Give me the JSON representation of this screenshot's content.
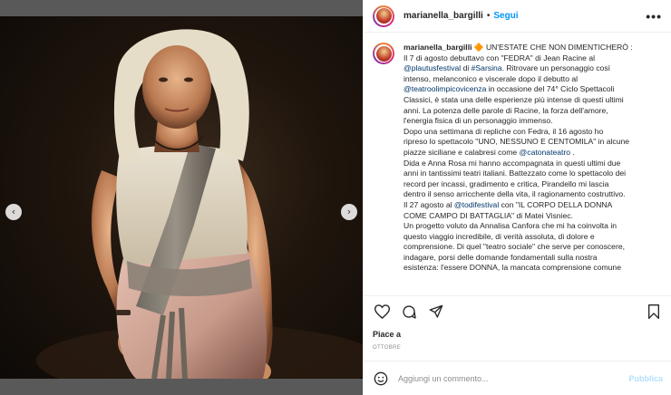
{
  "photo": {
    "prev_glyph": "‹",
    "next_glyph": "›",
    "carousel_dots": 6,
    "active_dot": 0
  },
  "header": {
    "username": "marianella_bargilli",
    "separator": "•",
    "follow_label": "Segui",
    "more_glyph": "•••"
  },
  "caption": {
    "username": "marianella_bargilli",
    "lines": [
      [
        "🔶 UN'ESTATE CHE NON DIMENTICHERÒ :",
        null
      ],
      [
        "Il 7 di agosto debuttavo con \"FEDRA\" di Jean Racine al",
        null
      ],
      [
        "@plautusfestival",
        " di ",
        "#Sarsina",
        ". Ritrovare un personaggio così"
      ],
      [
        "intenso, melanconico e viscerale dopo il debutto al",
        null
      ],
      [
        "@teatroolimpicovicenza",
        " in occasione del 74° Ciclo Spettacoli"
      ],
      [
        "Classici, è stata una delle esperienze più intense di questi ultimi",
        null
      ],
      [
        "anni. La potenza delle parole di Racine, la forza dell'amore,",
        null
      ],
      [
        "l'energia fisica di un personaggio immenso.",
        null
      ],
      [
        "Dopo una settimana di repliche con Fedra, il 16 agosto ho",
        null
      ],
      [
        "ripreso lo spettacolo \"UNO, NESSUNO E CENTOMILA\" in alcune",
        null
      ],
      [
        "piazze siciliane e calabresi come ",
        "@catonateatro",
        " ."
      ],
      [
        "Dida e Anna Rosa mi hanno accompagnata in questi ultimi due",
        null
      ],
      [
        "anni in tantissimi teatri italiani. Battezzato come lo spettacolo dei",
        null
      ],
      [
        "record per incassi, gradimento e critica, Pirandello mi lascia",
        null
      ],
      [
        "dentro il senso arricchente della vita, il ragionamento costruttivo.",
        null
      ],
      [
        "Il 27 agosto al ",
        "@todifestival",
        " con \"IL CORPO DELLA DONNA"
      ],
      [
        "COME CAMPO DI BATTAGLIA\" di Matei Visniec.",
        null
      ],
      [
        "Un progetto voluto da Annalisa Canfora che mi ha coinvolta in",
        null
      ],
      [
        "questo viaggio incredibile, di verità assoluta, di dolore e",
        null
      ],
      [
        "comprensione. Di quel \"teatro sociale\" che serve per conoscere,",
        null
      ],
      [
        "indagare, porsi delle domande fondamentali sulla nostra",
        null
      ],
      [
        "esistenza: l'essere DONNA, la mancata comprensione comune",
        null
      ]
    ]
  },
  "actions": {
    "like_icon": "heart-icon",
    "comment_icon": "comment-icon",
    "share_icon": "share-icon",
    "save_icon": "bookmark-icon"
  },
  "likes_text": "Piace a",
  "date_text": "OTTOBRE",
  "comment": {
    "placeholder": "Aggiungi un commento...",
    "publish_label": "Pubblica"
  },
  "colors": {
    "accent": "#0095f6",
    "link": "#00376b",
    "muted": "#8e8e8e"
  }
}
